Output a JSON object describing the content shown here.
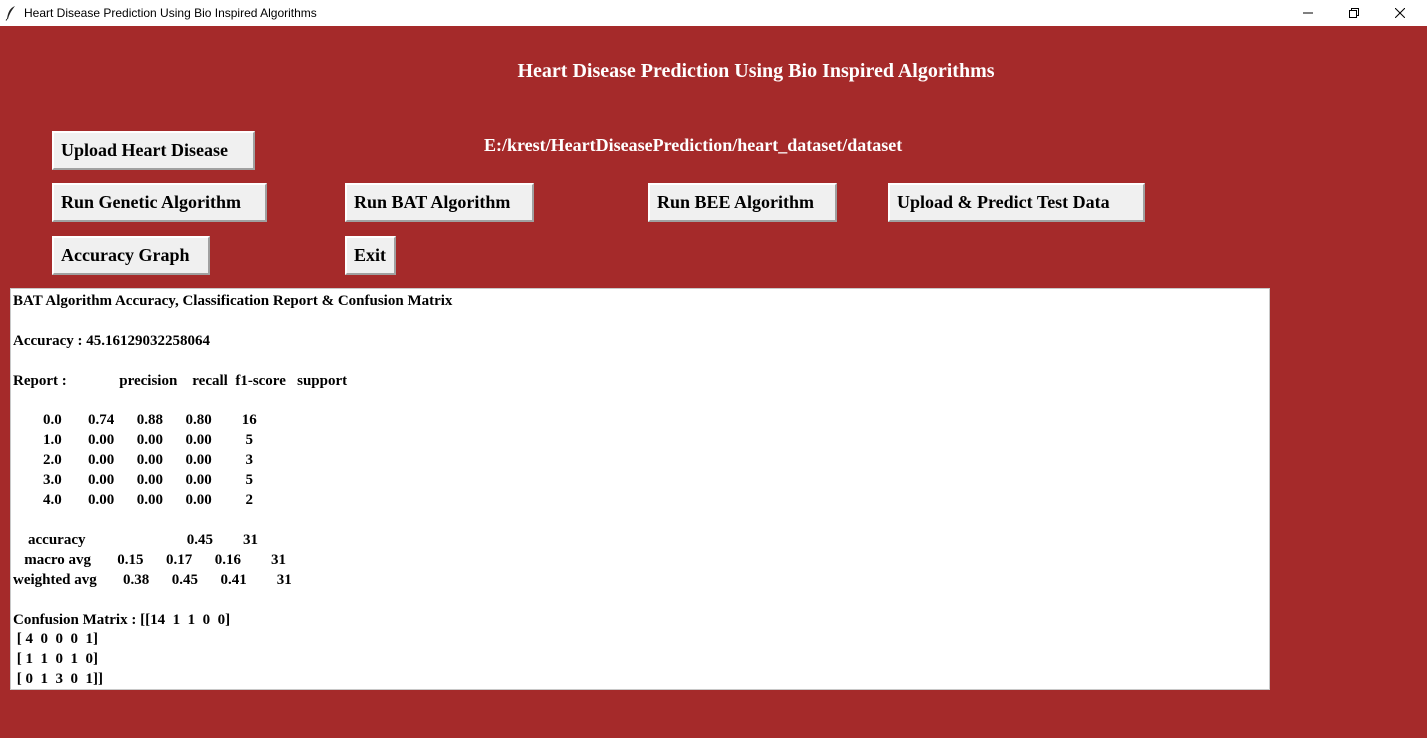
{
  "window": {
    "title": "Heart Disease Prediction Using Bio Inspired Algorithms",
    "icon": "feather-icon"
  },
  "header": {
    "title": "Heart Disease Prediction Using Bio Inspired Algorithms",
    "path": "E:/krest/HeartDiseasePrediction/heart_dataset/dataset"
  },
  "buttons": {
    "upload": "Upload Heart Disease",
    "genetic": "Run Genetic Algorithm",
    "bat": "Run BAT Algorithm",
    "bee": "Run BEE Algorithm",
    "predict": "Upload & Predict Test Data",
    "graph": "Accuracy Graph",
    "exit": "Exit"
  },
  "output": {
    "text": "BAT Algorithm Accuracy, Classification Report & Confusion Matrix\n\nAccuracy : 45.16129032258064\n\nReport :              precision    recall  f1-score   support\n\n        0.0       0.74      0.88      0.80        16\n        1.0       0.00      0.00      0.00         5\n        2.0       0.00      0.00      0.00         3\n        3.0       0.00      0.00      0.00         5\n        4.0       0.00      0.00      0.00         2\n\n    accuracy                           0.45        31\n   macro avg       0.15      0.17      0.16        31\nweighted avg       0.38      0.45      0.41        31\n\nConfusion Matrix : [[14  1  1  0  0]\n [ 4  0  0  0  1]\n [ 1  1  0  1  0]\n [ 0  1  3  0  1]]"
  },
  "colors": {
    "background": "#a52a2a",
    "button": "#f0f0f0",
    "text_area": "#ffffff"
  }
}
